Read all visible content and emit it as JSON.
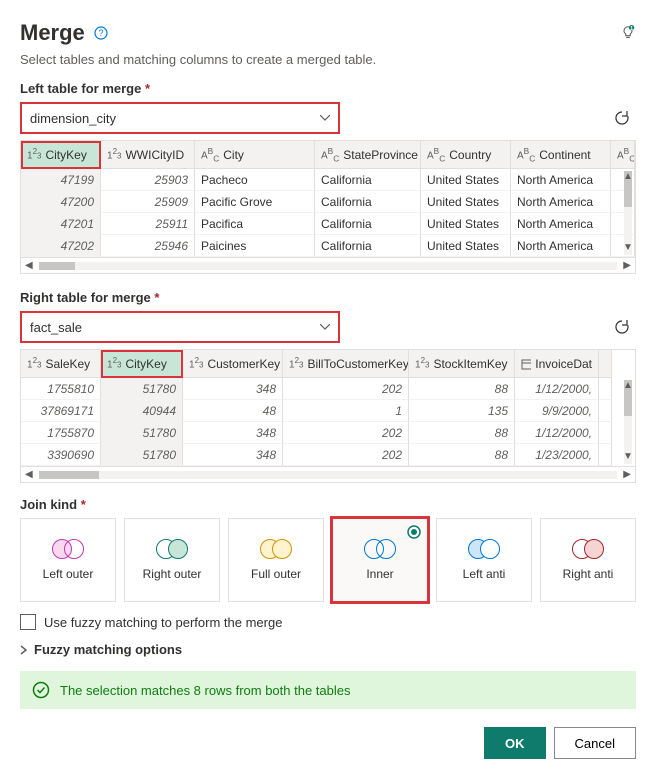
{
  "header": {
    "title": "Merge",
    "subtitle": "Select tables and matching columns to create a merged table."
  },
  "left": {
    "label": "Left table for merge",
    "value": "dimension_city",
    "columns": [
      "CityKey",
      "WWICityID",
      "City",
      "StateProvince",
      "Country",
      "Continent"
    ],
    "rows": [
      [
        "47199",
        "25903",
        "Pacheco",
        "California",
        "United States",
        "North America"
      ],
      [
        "47200",
        "25909",
        "Pacific Grove",
        "California",
        "United States",
        "North America"
      ],
      [
        "47201",
        "25911",
        "Pacifica",
        "California",
        "United States",
        "North America"
      ],
      [
        "47202",
        "25946",
        "Paicines",
        "California",
        "United States",
        "North America"
      ]
    ]
  },
  "right": {
    "label": "Right table for merge",
    "value": "fact_sale",
    "columns": [
      "SaleKey",
      "CityKey",
      "CustomerKey",
      "BillToCustomerKey",
      "StockItemKey",
      "InvoiceDat"
    ],
    "rows": [
      [
        "1755810",
        "51780",
        "348",
        "202",
        "88",
        "1/12/2000,"
      ],
      [
        "37869171",
        "40944",
        "48",
        "1",
        "135",
        "9/9/2000,"
      ],
      [
        "1755870",
        "51780",
        "348",
        "202",
        "88",
        "1/12/2000,"
      ],
      [
        "3390690",
        "51780",
        "348",
        "202",
        "88",
        "1/23/2000,"
      ]
    ]
  },
  "join": {
    "label": "Join kind",
    "options": [
      "Left outer",
      "Right outer",
      "Full outer",
      "Inner",
      "Left anti",
      "Right anti"
    ],
    "selected": "Inner"
  },
  "fuzzy": {
    "checkbox": "Use fuzzy matching to perform the merge",
    "expand": "Fuzzy matching options"
  },
  "success": "The selection matches 8 rows from both the tables",
  "buttons": {
    "ok": "OK",
    "cancel": "Cancel"
  }
}
